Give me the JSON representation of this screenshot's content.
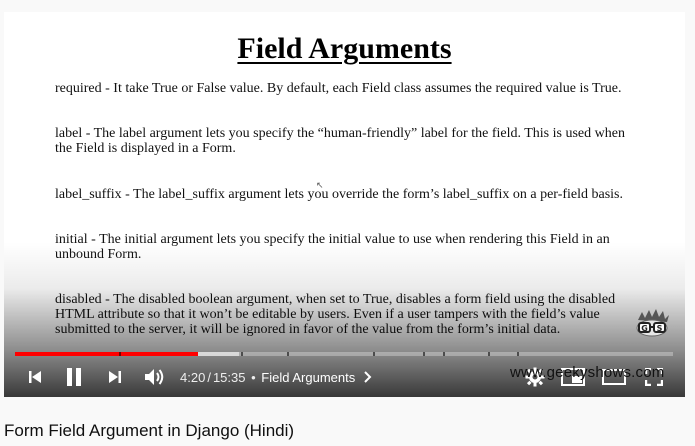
{
  "slide": {
    "title": "Field Arguments",
    "paragraphs": [
      "required - It take True or False value. By default, each Field class assumes the required value is True.",
      "label - The label argument lets you specify the “human-friendly” label for the field. This is used when the Field is displayed in a Form.",
      "label_suffix - The label_suffix argument lets you override the form’s label_suffix on a per-field basis.",
      "initial - The initial argument lets you specify the initial value to use when rendering this Field in an unbound Form.",
      "disabled - The disabled boolean argument, when set to True, disables a form field using the disabled HTML attribute so that it won’t be editable by users. Even if a user tampers with the field’s value submitted to the server, it will be ignored in favor of the value from the form’s initial data."
    ],
    "watermark": "www.geekyshows.com",
    "logo_icon": "geeky-shows-mascot-icon"
  },
  "player": {
    "current_time": "4:20",
    "duration": "15:35",
    "separator": "/",
    "bullet": "•",
    "chapter": "Field Arguments",
    "progress_fraction": 0.278,
    "buffered_fraction": 0.34,
    "colors": {
      "played": "#ff0000",
      "controls": "#ffffff"
    },
    "icons": [
      "skip-previous-icon",
      "pause-icon",
      "skip-next-icon",
      "volume-icon",
      "chevron-right-icon",
      "settings-gear-icon",
      "miniplayer-icon",
      "theater-mode-icon",
      "fullscreen-icon"
    ]
  },
  "video": {
    "title": "Form Field Argument in Django (Hindi)"
  }
}
